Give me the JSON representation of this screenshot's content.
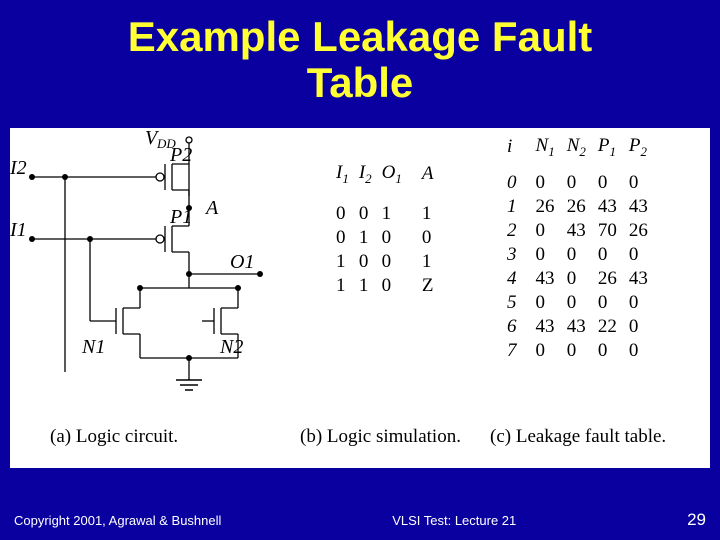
{
  "title_line1": "Example Leakage Fault",
  "title_line2": "Table",
  "circuit": {
    "vdd_v": "V",
    "vdd_dd": "DD",
    "i2": "I2",
    "i1": "I1",
    "p2": "P2",
    "p1": "P1",
    "a": "A",
    "o1": "O1",
    "n1": "N1",
    "n2": "N2"
  },
  "sim": {
    "h1": "I",
    "h1s": "1",
    "h2": "I",
    "h2s": "2",
    "h3": "O",
    "h3s": "1",
    "h4": "A",
    "rows": [
      [
        "0",
        "0",
        "1",
        "1"
      ],
      [
        "0",
        "1",
        "0",
        "0"
      ],
      [
        "1",
        "0",
        "0",
        "1"
      ],
      [
        "1",
        "1",
        "0",
        "Z"
      ]
    ]
  },
  "leak": {
    "hi": "i",
    "h1": "N",
    "h1s": "1",
    "h2": "N",
    "h2s": "2",
    "h3": "P",
    "h3s": "1",
    "h4": "P",
    "h4s": "2",
    "rows": [
      [
        "0",
        "0",
        "0",
        "0",
        "0"
      ],
      [
        "1",
        "26",
        "26",
        "43",
        "43"
      ],
      [
        "2",
        "0",
        "43",
        "70",
        "26"
      ],
      [
        "3",
        "0",
        "0",
        "0",
        "0"
      ],
      [
        "4",
        "43",
        "0",
        "26",
        "43"
      ],
      [
        "5",
        "0",
        "0",
        "0",
        "0"
      ],
      [
        "6",
        "43",
        "43",
        "22",
        "0"
      ],
      [
        "7",
        "0",
        "0",
        "0",
        "0"
      ]
    ]
  },
  "captions": {
    "a": "(a) Logic circuit.",
    "b": "(b) Logic simulation.",
    "c": "(c) Leakage fault table."
  },
  "footer": {
    "left": "Copyright 2001, Agrawal & Bushnell",
    "center": "VLSI Test: Lecture 21",
    "page": "29"
  },
  "chart_data": {
    "type": "table",
    "title": "Leakage fault table",
    "columns": [
      "i",
      "N1",
      "N2",
      "P1",
      "P2"
    ],
    "rows": [
      [
        0,
        0,
        0,
        0,
        0
      ],
      [
        1,
        26,
        26,
        43,
        43
      ],
      [
        2,
        0,
        43,
        70,
        26
      ],
      [
        3,
        0,
        0,
        0,
        0
      ],
      [
        4,
        43,
        0,
        26,
        43
      ],
      [
        5,
        0,
        0,
        0,
        0
      ],
      [
        6,
        43,
        43,
        22,
        0
      ],
      [
        7,
        0,
        0,
        0,
        0
      ]
    ],
    "logic_simulation": {
      "columns": [
        "I1",
        "I2",
        "O1",
        "A"
      ],
      "rows": [
        [
          0,
          0,
          1,
          1
        ],
        [
          0,
          1,
          0,
          0
        ],
        [
          1,
          0,
          0,
          1
        ],
        [
          1,
          1,
          0,
          "Z"
        ]
      ]
    }
  }
}
